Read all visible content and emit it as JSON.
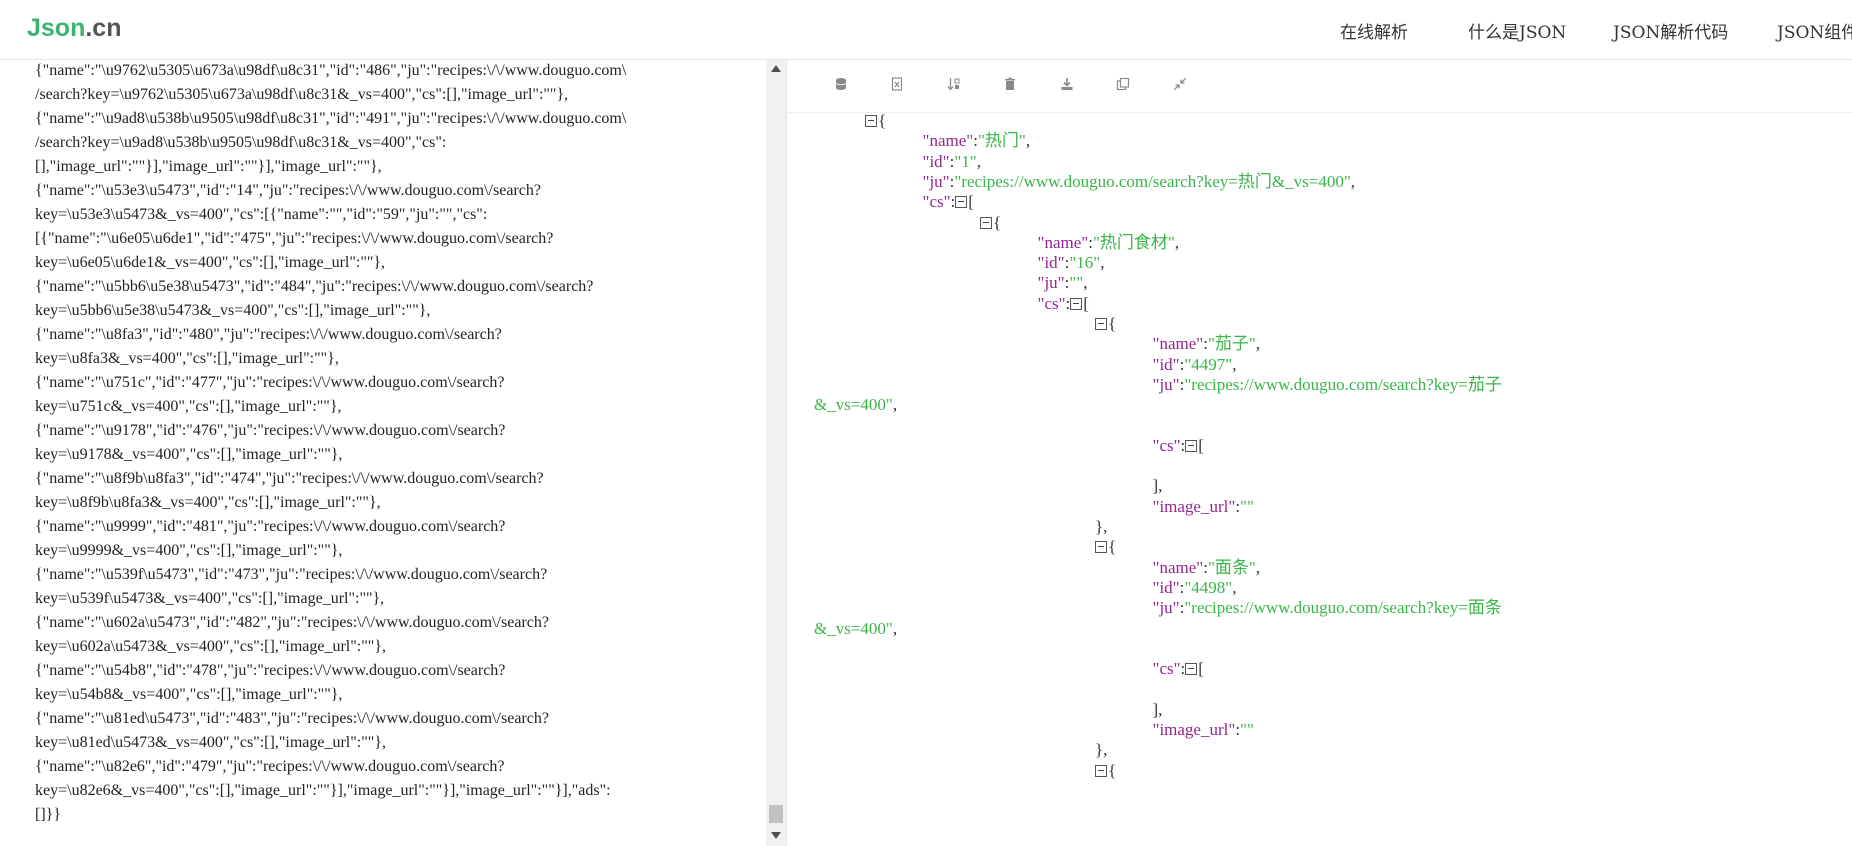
{
  "header": {
    "logo_main": "Json",
    "logo_tld": ".cn",
    "nav": [
      "在线解析",
      "什么是JSON",
      "JSON解析代码",
      "JSON组件"
    ]
  },
  "left_editor": {
    "lines": [
      "{\"name\":\"\\u9762\\u5305\\u673a\\u98df\\u8c31\",\"id\":\"486\",\"ju\":\"recipes:\\/\\/www.douguo.com\\",
      "/search?key=\\u9762\\u5305\\u673a\\u98df\\u8c31&_vs=400\",\"cs\":[],\"image_url\":\"\"},",
      "{\"name\":\"\\u9ad8\\u538b\\u9505\\u98df\\u8c31\",\"id\":\"491\",\"ju\":\"recipes:\\/\\/www.douguo.com\\",
      "/search?key=\\u9ad8\\u538b\\u9505\\u98df\\u8c31&_vs=400\",\"cs\":",
      "[],\"image_url\":\"\"}],\"image_url\":\"\"}],\"image_url\":\"\"},",
      "{\"name\":\"\\u53e3\\u5473\",\"id\":\"14\",\"ju\":\"recipes:\\/\\/www.douguo.com\\/search?",
      "key=\\u53e3\\u5473&_vs=400\",\"cs\":[{\"name\":\"\",\"id\":\"59\",\"ju\":\"\",\"cs\":",
      "[{\"name\":\"\\u6e05\\u6de1\",\"id\":\"475\",\"ju\":\"recipes:\\/\\/www.douguo.com\\/search?",
      "key=\\u6e05\\u6de1&_vs=400\",\"cs\":[],\"image_url\":\"\"},",
      "{\"name\":\"\\u5bb6\\u5e38\\u5473\",\"id\":\"484\",\"ju\":\"recipes:\\/\\/www.douguo.com\\/search?",
      "key=\\u5bb6\\u5e38\\u5473&_vs=400\",\"cs\":[],\"image_url\":\"\"},",
      "{\"name\":\"\\u8fa3\",\"id\":\"480\",\"ju\":\"recipes:\\/\\/www.douguo.com\\/search?",
      "key=\\u8fa3&_vs=400\",\"cs\":[],\"image_url\":\"\"},",
      "{\"name\":\"\\u751c\",\"id\":\"477\",\"ju\":\"recipes:\\/\\/www.douguo.com\\/search?",
      "key=\\u751c&_vs=400\",\"cs\":[],\"image_url\":\"\"},",
      "{\"name\":\"\\u9178\",\"id\":\"476\",\"ju\":\"recipes:\\/\\/www.douguo.com\\/search?",
      "key=\\u9178&_vs=400\",\"cs\":[],\"image_url\":\"\"},",
      "{\"name\":\"\\u8f9b\\u8fa3\",\"id\":\"474\",\"ju\":\"recipes:\\/\\/www.douguo.com\\/search?",
      "key=\\u8f9b\\u8fa3&_vs=400\",\"cs\":[],\"image_url\":\"\"},",
      "{\"name\":\"\\u9999\",\"id\":\"481\",\"ju\":\"recipes:\\/\\/www.douguo.com\\/search?",
      "key=\\u9999&_vs=400\",\"cs\":[],\"image_url\":\"\"},",
      "{\"name\":\"\\u539f\\u5473\",\"id\":\"473\",\"ju\":\"recipes:\\/\\/www.douguo.com\\/search?",
      "key=\\u539f\\u5473&_vs=400\",\"cs\":[],\"image_url\":\"\"},",
      "{\"name\":\"\\u602a\\u5473\",\"id\":\"482\",\"ju\":\"recipes:\\/\\/www.douguo.com\\/search?",
      "key=\\u602a\\u5473&_vs=400\",\"cs\":[],\"image_url\":\"\"},",
      "{\"name\":\"\\u54b8\",\"id\":\"478\",\"ju\":\"recipes:\\/\\/www.douguo.com\\/search?",
      "key=\\u54b8&_vs=400\",\"cs\":[],\"image_url\":\"\"},",
      "{\"name\":\"\\u81ed\\u5473\",\"id\":\"483\",\"ju\":\"recipes:\\/\\/www.douguo.com\\/search?",
      "key=\\u81ed\\u5473&_vs=400\",\"cs\":[],\"image_url\":\"\"},",
      "{\"name\":\"\\u82e6\",\"id\":\"479\",\"ju\":\"recipes:\\/\\/www.douguo.com\\/search?",
      "key=\\u82e6&_vs=400\",\"cs\":[],\"image_url\":\"\"}],\"image_url\":\"\"}],\"image_url\":\"\"}],\"ads\":",
      "[]}}"
    ]
  },
  "toolbar": {
    "buttons": [
      "database-icon",
      "excel-icon",
      "sort-icon",
      "trash-icon",
      "download-icon",
      "copy-icon",
      "compress-icon"
    ]
  },
  "tree_rows": [
    {
      "indent": 0,
      "parts": [
        [
          "tog",
          ""
        ],
        [
          "p",
          "{"
        ]
      ]
    },
    {
      "indent": 1,
      "parts": [
        [
          "k",
          "\"name\""
        ],
        [
          "p",
          ":"
        ],
        [
          "v",
          "\"热门\""
        ],
        [
          "p",
          ","
        ]
      ]
    },
    {
      "indent": 1,
      "parts": [
        [
          "k",
          "\"id\""
        ],
        [
          "p",
          ":"
        ],
        [
          "v",
          "\"1\""
        ],
        [
          "p",
          ","
        ]
      ]
    },
    {
      "indent": 1,
      "parts": [
        [
          "k",
          "\"ju\""
        ],
        [
          "p",
          ":"
        ],
        [
          "v",
          "\"recipes://www.douguo.com/search?key=热门&_vs=400\""
        ],
        [
          "p",
          ","
        ]
      ]
    },
    {
      "indent": 1,
      "parts": [
        [
          "k",
          "\"cs\""
        ],
        [
          "p",
          ":"
        ],
        [
          "tog",
          ""
        ],
        [
          "p",
          "["
        ]
      ]
    },
    {
      "indent": 2,
      "parts": [
        [
          "tog",
          ""
        ],
        [
          "p",
          "{"
        ]
      ]
    },
    {
      "indent": 3,
      "parts": [
        [
          "k",
          "\"name\""
        ],
        [
          "p",
          ":"
        ],
        [
          "v",
          "\"热门食材\""
        ],
        [
          "p",
          ","
        ]
      ]
    },
    {
      "indent": 3,
      "parts": [
        [
          "k",
          "\"id\""
        ],
        [
          "p",
          ":"
        ],
        [
          "v",
          "\"16\""
        ],
        [
          "p",
          ","
        ]
      ]
    },
    {
      "indent": 3,
      "parts": [
        [
          "k",
          "\"ju\""
        ],
        [
          "p",
          ":"
        ],
        [
          "v",
          "\"\""
        ],
        [
          "p",
          ","
        ]
      ]
    },
    {
      "indent": 3,
      "parts": [
        [
          "k",
          "\"cs\""
        ],
        [
          "p",
          ":"
        ],
        [
          "tog",
          ""
        ],
        [
          "p",
          "["
        ]
      ]
    },
    {
      "indent": 4,
      "parts": [
        [
          "tog",
          ""
        ],
        [
          "p",
          "{"
        ]
      ]
    },
    {
      "indent": 5,
      "parts": [
        [
          "k",
          "\"name\""
        ],
        [
          "p",
          ":"
        ],
        [
          "v",
          "\"茄子\""
        ],
        [
          "p",
          ","
        ]
      ]
    },
    {
      "indent": 5,
      "parts": [
        [
          "k",
          "\"id\""
        ],
        [
          "p",
          ":"
        ],
        [
          "v",
          "\"4497\""
        ],
        [
          "p",
          ","
        ]
      ]
    },
    {
      "indent": 5,
      "parts": [
        [
          "k",
          "\"ju\""
        ],
        [
          "p",
          ":"
        ],
        [
          "v",
          "\"recipes://www.douguo.com/search?key=茄子"
        ]
      ]
    },
    {
      "indent": -1,
      "parts": [
        [
          "v",
          "&_vs=400\""
        ],
        [
          "p",
          ","
        ]
      ]
    },
    {
      "indent": 5,
      "parts": []
    },
    {
      "indent": 5,
      "parts": [
        [
          "k",
          "\"cs\""
        ],
        [
          "p",
          ":"
        ],
        [
          "tog",
          ""
        ],
        [
          "p",
          "["
        ]
      ]
    },
    {
      "indent": 5,
      "parts": []
    },
    {
      "indent": 5,
      "parts": [
        [
          "p",
          "],"
        ]
      ]
    },
    {
      "indent": 5,
      "parts": [
        [
          "k",
          "\"image_url\""
        ],
        [
          "p",
          ":"
        ],
        [
          "v",
          "\"\""
        ]
      ]
    },
    {
      "indent": 4,
      "parts": [
        [
          "p",
          "},"
        ]
      ]
    },
    {
      "indent": 4,
      "parts": [
        [
          "tog",
          ""
        ],
        [
          "p",
          "{"
        ]
      ]
    },
    {
      "indent": 5,
      "parts": [
        [
          "k",
          "\"name\""
        ],
        [
          "p",
          ":"
        ],
        [
          "v",
          "\"面条\""
        ],
        [
          "p",
          ","
        ]
      ]
    },
    {
      "indent": 5,
      "parts": [
        [
          "k",
          "\"id\""
        ],
        [
          "p",
          ":"
        ],
        [
          "v",
          "\"4498\""
        ],
        [
          "p",
          ","
        ]
      ]
    },
    {
      "indent": 5,
      "parts": [
        [
          "k",
          "\"ju\""
        ],
        [
          "p",
          ":"
        ],
        [
          "v",
          "\"recipes://www.douguo.com/search?key=面条"
        ]
      ]
    },
    {
      "indent": -1,
      "parts": [
        [
          "v",
          "&_vs=400\""
        ],
        [
          "p",
          ","
        ]
      ]
    },
    {
      "indent": 5,
      "parts": []
    },
    {
      "indent": 5,
      "parts": [
        [
          "k",
          "\"cs\""
        ],
        [
          "p",
          ":"
        ],
        [
          "tog",
          ""
        ],
        [
          "p",
          "["
        ]
      ]
    },
    {
      "indent": 5,
      "parts": []
    },
    {
      "indent": 5,
      "parts": [
        [
          "p",
          "],"
        ]
      ]
    },
    {
      "indent": 5,
      "parts": [
        [
          "k",
          "\"image_url\""
        ],
        [
          "p",
          ":"
        ],
        [
          "v",
          "\"\""
        ]
      ]
    },
    {
      "indent": 4,
      "parts": [
        [
          "p",
          "},"
        ]
      ]
    },
    {
      "indent": 4,
      "parts": [
        [
          "tog",
          ""
        ],
        [
          "p",
          "{"
        ]
      ]
    }
  ]
}
